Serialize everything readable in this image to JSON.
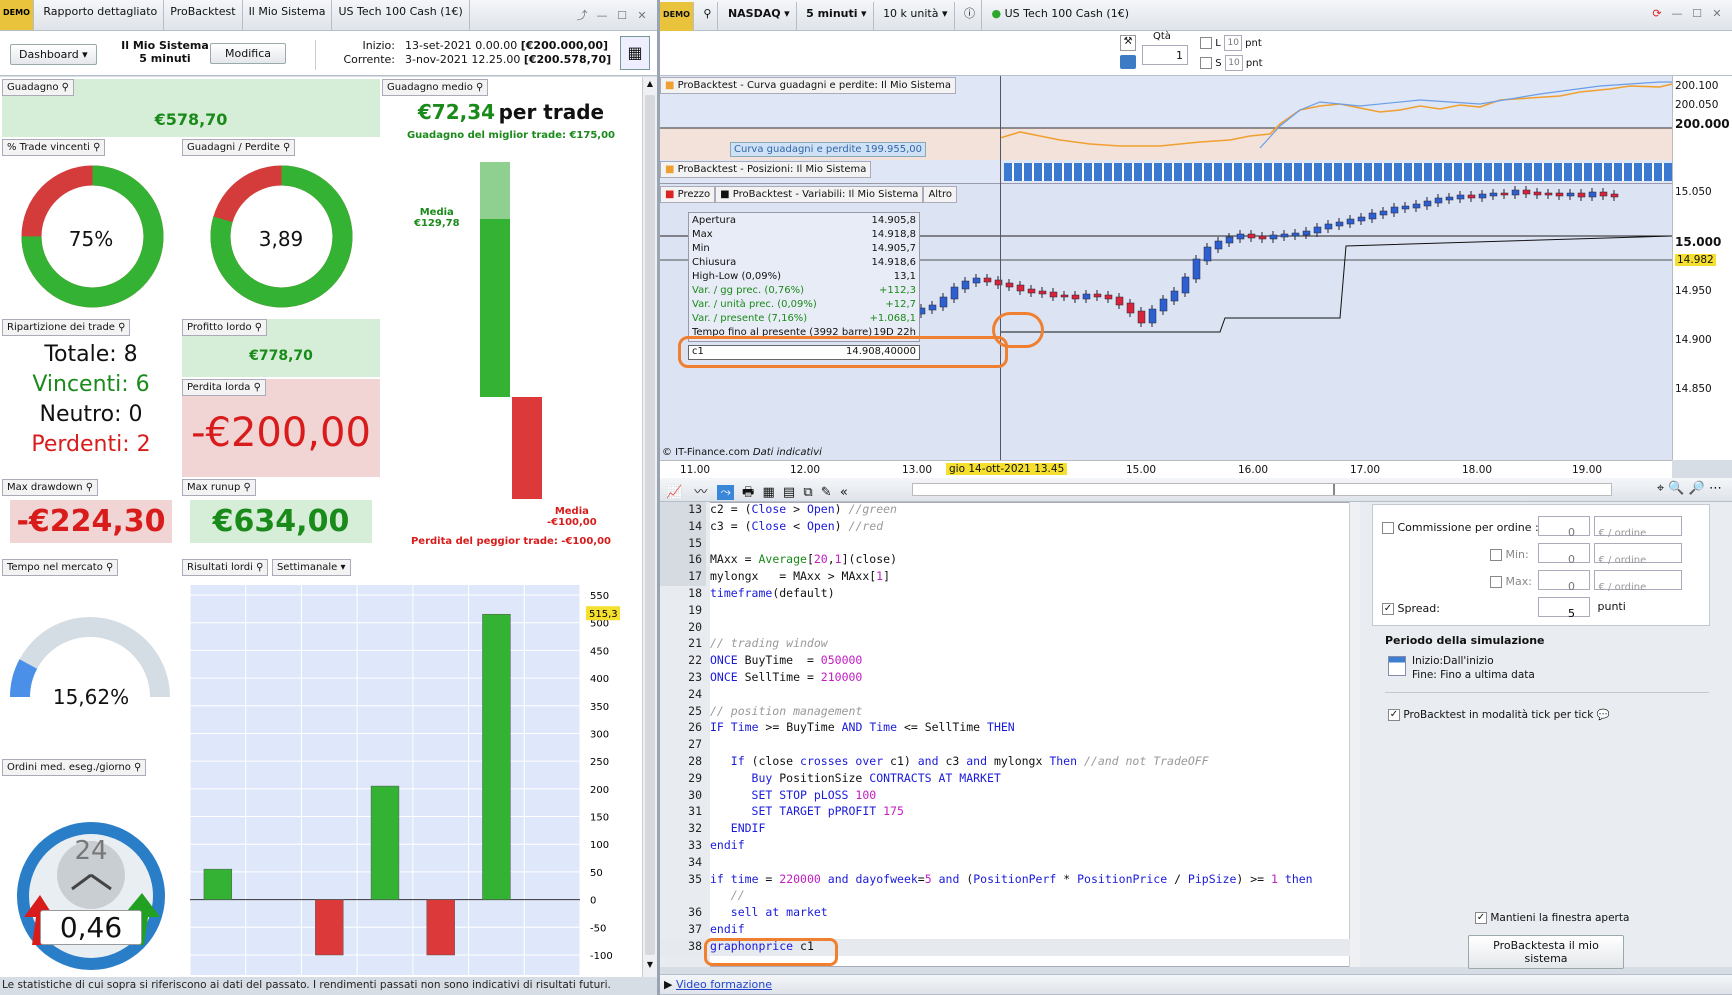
{
  "left_tabs": [
    "Rapporto dettagliato",
    "ProBacktest",
    "Il Mio Sistema",
    "US Tech 100 Cash (1€)"
  ],
  "dashboard_btn": "Dashboard",
  "system": {
    "name": "Il Mio Sistema",
    "tf": "5 minuti",
    "edit": "Modifica"
  },
  "dates": {
    "start_label": "Inizio:",
    "start": "13-set-2021 0.00.00",
    "start_val": "[€200.000,00]",
    "cur_label": "Corrente:",
    "cur": "3-nov-2021 12.25.00",
    "cur_val": "[€200.578,70]"
  },
  "guadagno": {
    "label": "Guadagno",
    "value": "€578,70"
  },
  "guadagno_medio": {
    "label": "Guadagno medio",
    "value": "€72,34",
    "suffix": "per trade",
    "best": "Guadagno del miglior trade: €175,00",
    "media_pos": "Media",
    "media_pos_val": "€129,78",
    "media_neg": "Media",
    "media_neg_val": "-€100,00",
    "worst": "Perdita del peggior trade: -€100,00",
    "ratio_pos": 0.757,
    "ratio_neg": 0.432
  },
  "trade_vincenti": {
    "label": "% Trade vincenti",
    "value": "75%",
    "ratio": 0.75
  },
  "guadagni_perdite": {
    "label": "Guadagni / Perdite",
    "value": "3,89",
    "ratio": 0.795
  },
  "ripartizione": {
    "label": "Ripartizione dei trade",
    "totale": "Totale: 8",
    "vincenti": "Vincenti: 6",
    "neutro": "Neutro: 0",
    "perdenti": "Perdenti: 2"
  },
  "profitto_lordo": {
    "label": "Profitto lordo",
    "value": "€778,70"
  },
  "perdita_lorda": {
    "label": "Perdita lorda",
    "value": "-€200,00"
  },
  "max_drawdown": {
    "label": "Max drawdown",
    "value": "-€224,30"
  },
  "max_runup": {
    "label": "Max runup",
    "value": "€634,00"
  },
  "tempo_mercato": {
    "label": "Tempo nel mercato",
    "value": "15,62%",
    "ratio": 0.1562
  },
  "ordini": {
    "label": "Ordini med. eseg./giorno",
    "value": "0,46",
    "clock": "24"
  },
  "risultati": {
    "label": "Risultati lordi",
    "period": "Settimanale",
    "last": "515,3",
    "ticks": [
      "550",
      "500",
      "450",
      "400",
      "350",
      "300",
      "250",
      "200",
      "150",
      "100",
      "50",
      "0",
      "-50",
      "-100"
    ]
  },
  "chart_data": {
    "type": "bar",
    "title": "Risultati lordi",
    "ylim": [
      -100,
      550
    ],
    "categories": [
      "",
      "",
      "",
      "",
      "",
      "",
      ""
    ],
    "values": [
      55,
      0,
      -100,
      205,
      -100,
      515.3,
      0
    ]
  },
  "footer_note": "Le statistiche di cui sopra si riferiscono ai dati del passato. I rendimenti passati non sono indicativi di risultati futuri.",
  "right_toolbar": {
    "market": "NASDAQ",
    "tf": "5 minuti",
    "units": "10 k unità",
    "instrument": "US Tech 100 Cash (1€)",
    "qty_label": "Qtà",
    "qty": "1",
    "l": "L",
    "s": "S",
    "pts": "10",
    "pnt": "pnt"
  },
  "curve": {
    "label": "ProBacktest - Curva guadagni e perdite: Il Mio Sistema",
    "tooltip": "Curva guadagni e perdite   199.955,00",
    "y1": "200.100",
    "y2": "200.050",
    "y3": "200.000"
  },
  "positions_label": "ProBacktest - Posizioni: Il Mio Sistema",
  "price_tabs": {
    "prezzo": "Prezzo",
    "variabili": "ProBacktest - Variabili: Il Mio Sistema",
    "altro": "Altro"
  },
  "ohlc": [
    [
      "Apertura",
      "14.905,8"
    ],
    [
      "Max",
      "14.918,8"
    ],
    [
      "Min",
      "14.905,7"
    ],
    [
      "Chiusura",
      "14.918,6"
    ]
  ],
  "ohlc_green": [
    [
      "High-Low (0,09%)",
      "13,1"
    ],
    [
      "Var. / gg prec. (0,76%)",
      "+112,3"
    ],
    [
      "Var. / unità prec. (0,09%)",
      "+12,7"
    ],
    [
      "Var. / presente (7,16%)",
      "+1.068,1"
    ]
  ],
  "tempo_present": [
    "Tempo fino al presente (3992 barre)",
    "19D 22h"
  ],
  "c1": [
    "c1",
    "14.908,40000"
  ],
  "price_axis": [
    "15.050",
    "15.000",
    "14.982",
    "14.950",
    "14.900",
    "14.850"
  ],
  "copyright": "© IT-Finance.com",
  "indicativi": "Dati indicativi",
  "dates_axis": [
    "11.00",
    "12.00",
    "13.00",
    "gio 14-ott-2021 13.45",
    "15.00",
    "16.00",
    "17.00",
    "18.00",
    "19.00"
  ],
  "code_lines": [
    {
      "n": "13",
      "html": "c2 = (<span class='kw'>Close</span> &gt; <span class='kw'>Open</span>) <span class='cm'>//green</span>"
    },
    {
      "n": "14",
      "html": "c3 = (<span class='kw'>Close</span> &lt; <span class='kw'>Open</span>) <span class='cm'>//red</span>"
    },
    {
      "n": "15",
      "html": ""
    },
    {
      "n": "16",
      "html": "MAxx = <span class='fn'>Average</span>[<span class='num'>20</span>,<span class='num'>1</span>](close)"
    },
    {
      "n": "17",
      "html": "mylongx   = MAxx &gt; MAxx[<span class='num'>1</span>]"
    },
    {
      "n": "18",
      "html": "<span class='kw'>timeframe</span>(default)"
    },
    {
      "n": "19",
      "html": ""
    },
    {
      "n": "20",
      "html": ""
    },
    {
      "n": "21",
      "html": "<span class='cm'>// trading window</span>"
    },
    {
      "n": "22",
      "html": "<span class='kw'>ONCE</span> BuyTime  = <span class='num'>050000</span>"
    },
    {
      "n": "23",
      "html": "<span class='kw'>ONCE</span> SellTime = <span class='num'>210000</span>"
    },
    {
      "n": "24",
      "html": ""
    },
    {
      "n": "25",
      "html": "<span class='cm'>// position management</span>"
    },
    {
      "n": "26",
      "html": "<span class='kw'>IF</span> <span class='kw'>Time</span> &gt;= BuyTime <span class='kw'>AND</span> <span class='kw'>Time</span> &lt;= SellTime <span class='kw'>THEN</span>"
    },
    {
      "n": "27",
      "html": ""
    },
    {
      "n": "28",
      "html": "   <span class='kw'>If</span> (close <span class='kw'>crosses over</span> c1) <span class='kw'>and</span> c3 <span class='kw'>and</span> mylongx <span class='kw'>Then</span> <span class='cm'>//and not TradeOFF</span>"
    },
    {
      "n": "29",
      "html": "      <span class='kw'>Buy</span> PositionSize <span class='kw'>CONTRACTS AT MARKET</span>"
    },
    {
      "n": "30",
      "html": "      <span class='kw'>SET STOP pLOSS</span> <span class='num'>100</span>"
    },
    {
      "n": "31",
      "html": "      <span class='kw'>SET TARGET pPROFIT</span> <span class='num'>175</span>"
    },
    {
      "n": "32",
      "html": "   <span class='kw'>ENDIF</span>"
    },
    {
      "n": "33",
      "html": "<span class='kw'>endif</span>"
    },
    {
      "n": "34",
      "html": ""
    },
    {
      "n": "35",
      "html": "<span class='kw'>if</span> <span class='kw'>time</span> = <span class='num'>220000</span> <span class='kw'>and</span> <span class='kw'>dayofweek</span>=<span class='num'>5</span> <span class='kw'>and</span> (<span class='kw'>PositionPerf</span> * <span class='kw'>PositionPrice</span> / <span class='kw'>PipSize</span>) &gt;= <span class='num'>1</span> <span class='kw'>then</span>"
    },
    {
      "n": "",
      "html": "   <span class='cm'>//</span>"
    },
    {
      "n": "36",
      "html": "   <span class='kw'>sell at market</span>"
    },
    {
      "n": "37",
      "html": "<span class='kw'>endif</span>"
    },
    {
      "n": "38",
      "html": "<span class='kw'>graphonprice</span> c1"
    }
  ],
  "settings": {
    "commissione": "Commissione per ordine :",
    "min": "Min:",
    "max": "Max:",
    "zero": "0",
    "ordine": "€ / ordine",
    "spread": "Spread:",
    "spread_val": "5",
    "punti": "punti",
    "periodo": "Periodo della simulazione",
    "inizio": "Inizio:Dall'inizio",
    "fine": "Fine: Fino a ultima data",
    "tick": "ProBacktest in modalità tick per tick",
    "mantieni": "Mantieni la finestra aperta",
    "run": "ProBacktesta il mio sistema"
  },
  "video": "Video formazione"
}
